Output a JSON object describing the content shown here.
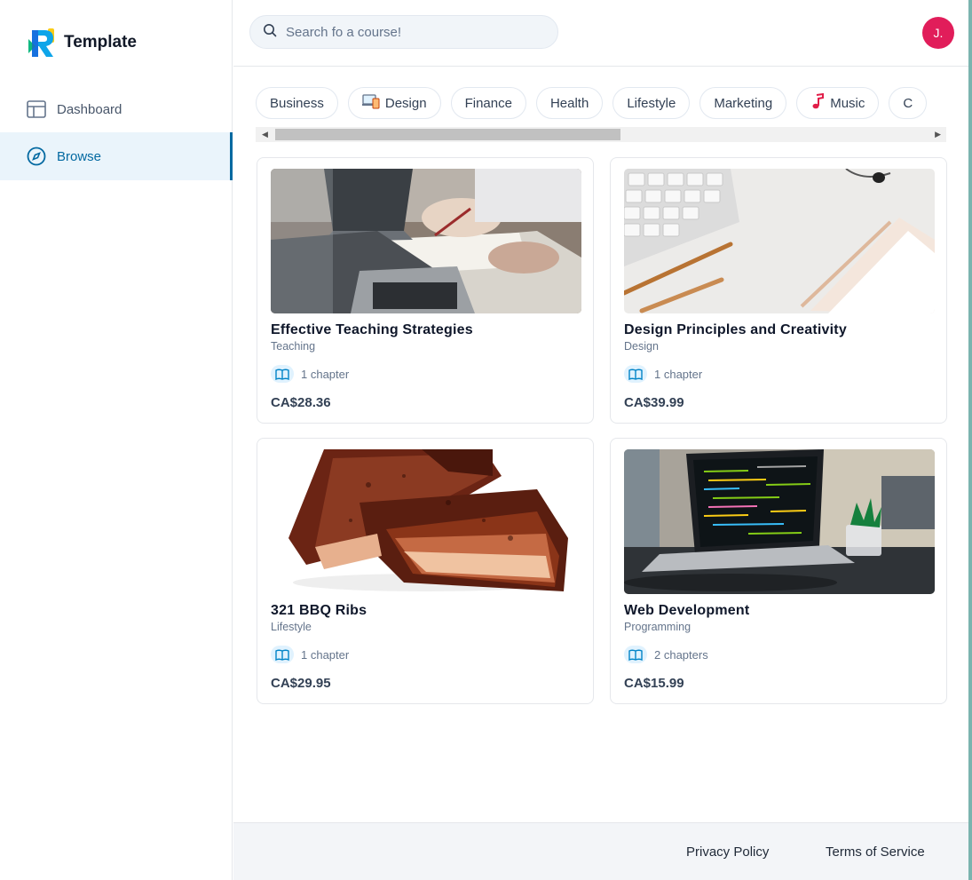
{
  "brand": {
    "name": "Template"
  },
  "sidebar": {
    "items": [
      {
        "label": "Dashboard",
        "icon": "layout-icon",
        "active": false
      },
      {
        "label": "Browse",
        "icon": "compass-icon",
        "active": true
      }
    ]
  },
  "search": {
    "placeholder": "Search fo a course!",
    "value": ""
  },
  "user": {
    "initial": "J."
  },
  "categories": [
    {
      "label": "Business",
      "icon": ""
    },
    {
      "label": "Design",
      "icon": "devices-icon"
    },
    {
      "label": "Finance",
      "icon": ""
    },
    {
      "label": "Health",
      "icon": ""
    },
    {
      "label": "Lifestyle",
      "icon": ""
    },
    {
      "label": "Marketing",
      "icon": ""
    },
    {
      "label": "Music",
      "icon": "music-note-icon"
    },
    {
      "label": "C",
      "icon": ""
    }
  ],
  "courses": [
    {
      "title": "Effective Teaching Strategies",
      "category": "Teaching",
      "chapters": "1 chapter",
      "price": "CA$28.36"
    },
    {
      "title": "Design Principles and Creativity",
      "category": "Design",
      "chapters": "1 chapter",
      "price": "CA$39.99"
    },
    {
      "title": "321 BBQ Ribs",
      "category": "Lifestyle",
      "chapters": "1 chapter",
      "price": "CA$29.95"
    },
    {
      "title": "Web Development",
      "category": "Programming",
      "chapters": "2 chapters",
      "price": "CA$15.99"
    }
  ],
  "footer": {
    "privacy": "Privacy Policy",
    "terms": "Terms of Service"
  },
  "colors": {
    "accent": "#0369a1",
    "avatar": "#e11d5a",
    "active_bg": "#eaf4fb"
  }
}
